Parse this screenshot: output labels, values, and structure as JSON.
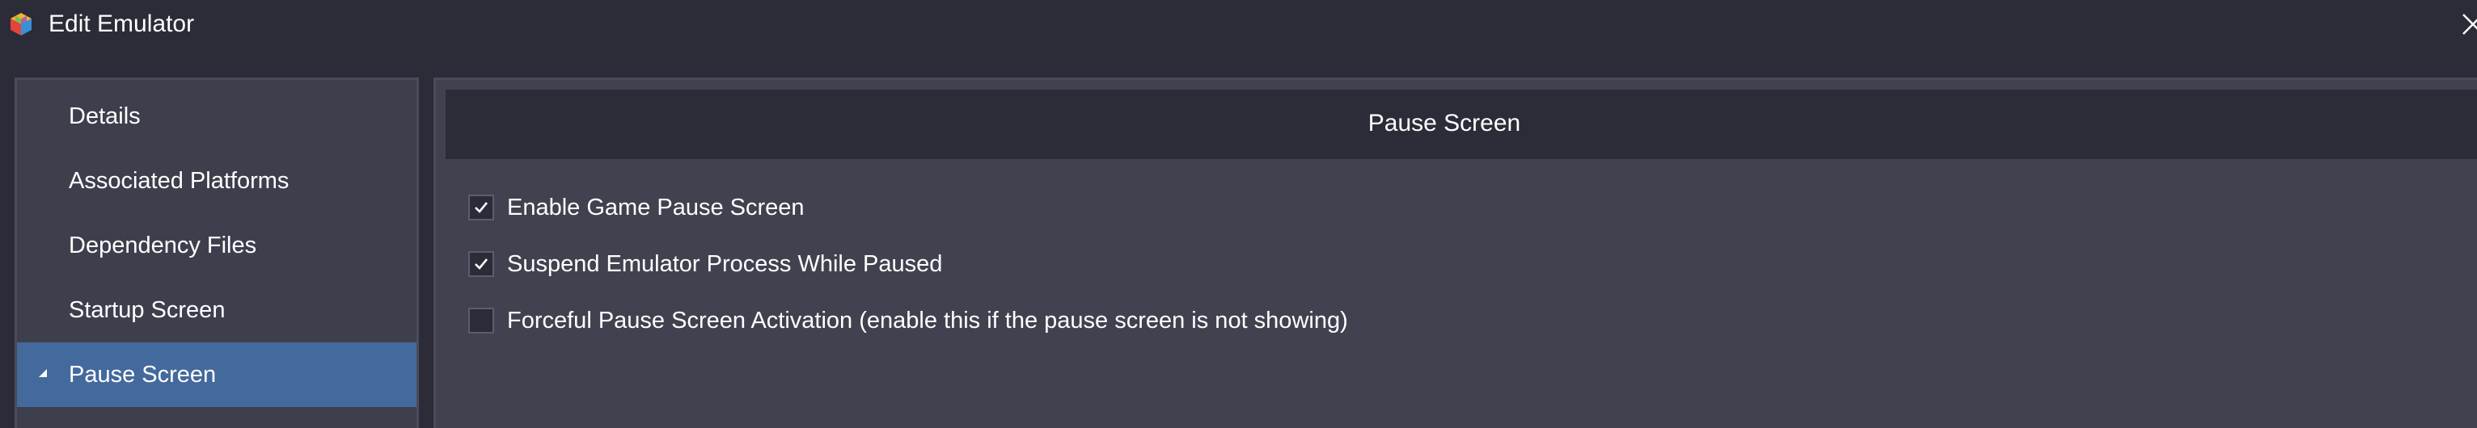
{
  "window": {
    "title": "Edit Emulator",
    "app_icon": "launchbox-cube-icon",
    "close_icon": "close-icon"
  },
  "sidebar": {
    "items": [
      {
        "label": "Details",
        "selected": false
      },
      {
        "label": "Associated Platforms",
        "selected": false
      },
      {
        "label": "Dependency Files",
        "selected": false
      },
      {
        "label": "Startup Screen",
        "selected": false
      },
      {
        "label": "Pause Screen",
        "selected": true,
        "expander_icon": "collapse-triangle-icon"
      }
    ],
    "selected_color": "#44699c"
  },
  "main": {
    "section_title": "Pause Screen",
    "options": [
      {
        "label": "Enable Game Pause Screen",
        "checked": true
      },
      {
        "label": "Suspend Emulator Process While Paused",
        "checked": true
      },
      {
        "label": "Forceful Pause Screen Activation (enable this if the pause screen is not showing)",
        "checked": false
      }
    ]
  },
  "colors": {
    "background": "#2b2c38",
    "panel": "#41424f",
    "sidebar": "#3e3f4d",
    "accent": "#44699c"
  }
}
